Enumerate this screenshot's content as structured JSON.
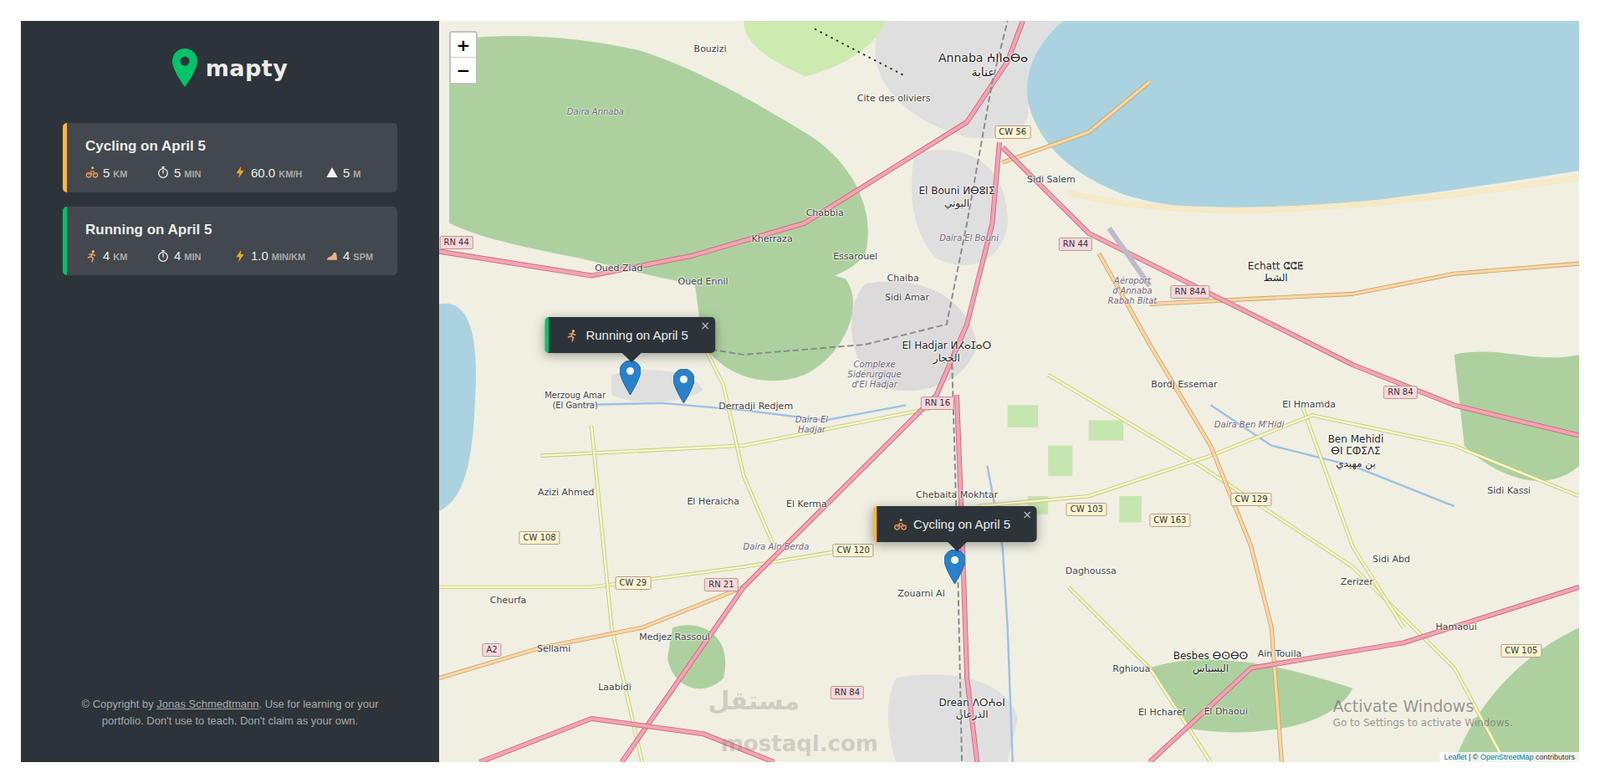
{
  "sidebar": {
    "logo": "mapty",
    "workouts": [
      {
        "kind": "cycling",
        "title": "Cycling on April 5",
        "color": "#ffb545",
        "stats": [
          {
            "kind": "distance",
            "value": "5",
            "unit": "KM"
          },
          {
            "kind": "duration",
            "value": "5",
            "unit": "MIN"
          },
          {
            "kind": "speed",
            "value": "60.0",
            "unit": "KM/H"
          },
          {
            "kind": "elevation",
            "value": "5",
            "unit": "M"
          }
        ]
      },
      {
        "kind": "running",
        "title": "Running on April 5",
        "color": "#00c46a",
        "stats": [
          {
            "kind": "distance",
            "value": "4",
            "unit": "KM"
          },
          {
            "kind": "duration",
            "value": "4",
            "unit": "MIN"
          },
          {
            "kind": "pace",
            "value": "1.0",
            "unit": "MIN/KM"
          },
          {
            "kind": "cadence",
            "value": "4",
            "unit": "SPM"
          }
        ]
      }
    ],
    "copyright": {
      "prefix": "© Copyright by ",
      "author": "Jonas Schmedtmann",
      "suffix": ". Use for learning or your portfolio. Don't use to teach. Don't claim as your own."
    }
  },
  "map": {
    "zoom": [
      "+",
      "−"
    ],
    "close": "×",
    "markers": [
      {
        "open": true,
        "kind": "running",
        "label": "Running on April 5",
        "color": "#00c46a"
      },
      {
        "open": false
      },
      {
        "open": true,
        "kind": "cycling",
        "label": "Cycling on April 5",
        "color": "#ffb545"
      }
    ],
    "places": [
      [
        "Annaba ⵄⵏⵏⴰⴱⴰ",
        "عنابة"
      ],
      [
        "Bouzizi"
      ],
      [
        "Cite des oliviers"
      ],
      [
        "El Bouni ⵍⴱⵓⵏⵉ",
        "البوني"
      ],
      [
        "Sidi Salem"
      ],
      [
        "Chabbia"
      ],
      [
        "Kherraza"
      ],
      [
        "Essarouel"
      ],
      [
        "Oued Ziad"
      ],
      [
        "Oued Ennil"
      ],
      [
        "Chaiba"
      ],
      [
        "Sidi Amar"
      ],
      [
        "El Hadjar ⵍⵃⴰⵊⴰⵔ",
        "الحجار"
      ],
      [
        "Echatt ⵛⵛⵟ",
        "الشط"
      ],
      [
        "Bordj Essemar"
      ],
      [
        "El Hmamda"
      ],
      [
        "Ben Mehidi",
        "ⴱⵏ ⵎⵀⵉⴷⵉ",
        "بن مهيدي"
      ],
      [
        "Merzoug Amar",
        "(El Gantra)"
      ],
      [
        "Derradji Redjem"
      ],
      [
        "Azizi Ahmed"
      ],
      [
        "El Heraicha"
      ],
      [
        "El Kerma"
      ],
      [
        "Chebaita Mokhtar"
      ],
      [
        "Daghoussa"
      ],
      [
        "Zouarni Al"
      ],
      [
        "Cheurfa"
      ],
      [
        "Sellami"
      ],
      [
        "Medjez Rassoul"
      ],
      [
        "Laabidi"
      ],
      [
        "Drean ⴷⵔⵄⴰⵏ",
        "الذرعان"
      ],
      [
        "Besbes ⴱⵙⴱⵙ",
        "البسباس"
      ],
      [
        "Ain Touila"
      ],
      [
        "Rghioua"
      ],
      [
        "El Hcharef"
      ],
      [
        "El Dhaoui"
      ],
      [
        "Sidi Abd"
      ],
      [
        "Zerizer"
      ],
      [
        "Hamaoui"
      ],
      [
        "Sidi Kassi"
      ]
    ],
    "areas": [
      "Daira Annaba",
      "Daira El Bouni",
      "Complexe Sidérurgique d'El Hadjar",
      "Daira El Hadjar",
      "Aéroport d'Annaba Rabah Bitat",
      "Daira Ain Berda",
      "Daira Ben M'Hidi"
    ],
    "roads": [
      {
        "label": "RN 44",
        "color": "#f9d6dc"
      },
      {
        "label": "RN 44",
        "color": "#f9d6dc"
      },
      {
        "label": "CW 56",
        "color": "#fbf4cf"
      },
      {
        "label": "RN 84A",
        "color": "#f9d6dc"
      },
      {
        "label": "RN 84",
        "color": "#f9d6dc"
      },
      {
        "label": "RN 16",
        "color": "#f9d6dc"
      },
      {
        "label": "CW 103",
        "color": "#fbf4cf"
      },
      {
        "label": "CW 163",
        "color": "#fbf4cf"
      },
      {
        "label": "CW 129",
        "color": "#fbf4cf"
      },
      {
        "label": "CW 108",
        "color": "#fbf4cf"
      },
      {
        "label": "CW 120",
        "color": "#fbf4cf"
      },
      {
        "label": "CW 29",
        "color": "#fbf4cf"
      },
      {
        "label": "RN 21",
        "color": "#f9d6dc"
      },
      {
        "label": "A2",
        "color": "#f9d6dc"
      },
      {
        "label": "RN 84",
        "color": "#f9d6dc"
      },
      {
        "label": "CW 105",
        "color": "#fbf4cf"
      }
    ],
    "watermark": [
      "مستقل",
      "mostaql.com"
    ],
    "activation": {
      "title": "Activate Windows",
      "subtitle": "Go to Settings to activate Windows."
    },
    "attribution": {
      "leaflet": "Leaflet",
      "separator": " | © ",
      "osm": "OpenStreetMap",
      "suffix": " contributors"
    }
  }
}
